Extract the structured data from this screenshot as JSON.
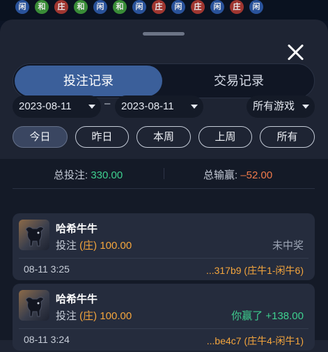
{
  "road": {
    "beads": [
      {
        "label": "闲",
        "kind": "xian"
      },
      {
        "label": "和",
        "kind": "he"
      },
      {
        "label": "庄",
        "kind": "zhuang"
      },
      {
        "label": "和",
        "kind": "he"
      },
      {
        "label": "闲",
        "kind": "xian"
      },
      {
        "label": "和",
        "kind": "he"
      },
      {
        "label": "闲",
        "kind": "xian"
      },
      {
        "label": "庄",
        "kind": "zhuang"
      },
      {
        "label": "闲",
        "kind": "xian"
      },
      {
        "label": "庄",
        "kind": "zhuang"
      },
      {
        "label": "闲",
        "kind": "xian"
      },
      {
        "label": "庄",
        "kind": "zhuang"
      },
      {
        "label": "闲",
        "kind": "xian"
      }
    ]
  },
  "tabs": {
    "active": "投注记录",
    "inactive": "交易记录"
  },
  "filters": {
    "date_from": "2023-08-11",
    "date_to": "2023-08-11",
    "dash": "–",
    "game": "所有游戏"
  },
  "periods": [
    "今日",
    "昨日",
    "本周",
    "上周",
    "所有"
  ],
  "summary": {
    "bet_label": "总投注: ",
    "bet_value": "330.00",
    "win_label": "总输赢: ",
    "win_value": "–52.00"
  },
  "records": [
    {
      "game": "哈希牛牛",
      "bet_prefix": "投注 ",
      "bet_amount": "(庄) 100.00",
      "result": "未中奖",
      "time": "08-11 3:25",
      "round": "...317b9 (庄牛1-闲牛6)"
    },
    {
      "game": "哈希牛牛",
      "bet_prefix": "投注 ",
      "bet_amount": "(庄) 100.00",
      "result": "你赢了 +138.00",
      "time": "08-11 3:24",
      "round": "...be4c7 (庄牛4-闲牛1)"
    }
  ],
  "colors": {
    "accent": "#3b5f9a",
    "positive": "#3ed08f",
    "negative": "#f07a4a",
    "amount": "#f4a53d"
  }
}
